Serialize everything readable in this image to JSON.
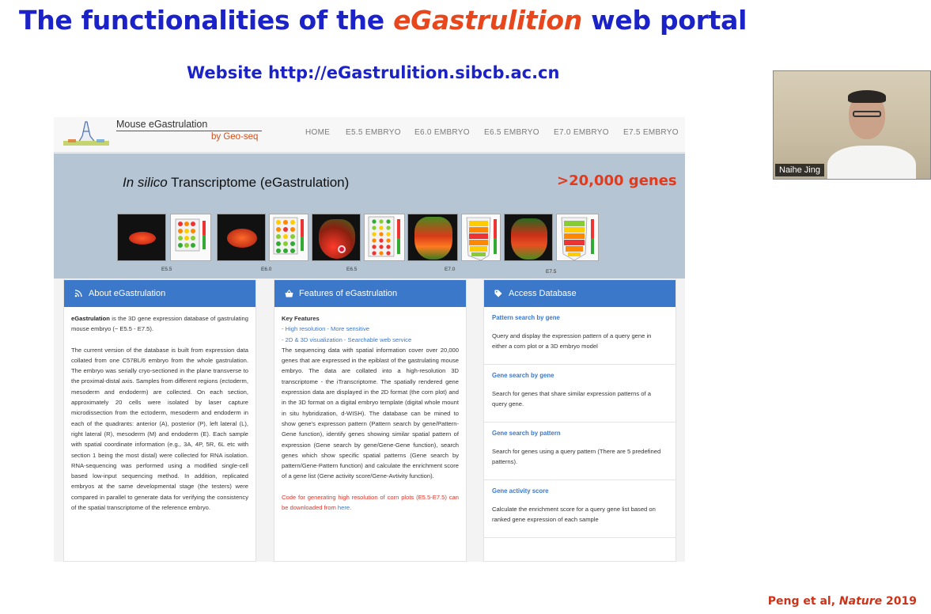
{
  "slide": {
    "title_before": "The functionalities of the ",
    "title_highlight": "eGastrulition",
    "title_after": " web portal",
    "website": "Website http://eGastrulition.sibcb.ac.cn",
    "citation_authors": "Peng et al, ",
    "citation_journal": "Nature",
    "citation_year": " 2019"
  },
  "webcam": {
    "participant_name": "Naihe Jing"
  },
  "site": {
    "logo_title": "Mouse  eGastrulation",
    "logo_sub": "by Geo-seq",
    "nav": [
      "HOME",
      "E5.5 EMBRYO",
      "E6.0 EMBRYO",
      "E6.5 EMBRYO",
      "E7.0 EMBRYO",
      "E7.5 EMBRYO"
    ],
    "hero": {
      "text_italic": "In silico",
      "text_rest": "  Transcriptome   (eGastrulation)",
      "genes": ">20,000 genes",
      "stages": [
        "E5.5",
        "E6.0",
        "E6.5",
        "E7.0",
        "E7.5"
      ]
    },
    "about": {
      "heading": "About eGastrulation",
      "bold_name": "eGastrulation",
      "intro": " is the 3D gene expression database of gastrulating mouse embryo (~ E5.5 - E7.5).",
      "body": "The current version of the database is built from expression data collated from one C57BL/6 embryo from the whole gastrulation. The embryo was serially cryo-sectioned in the plane transverse to the proximal-distal axis. Samples from different regions (ectoderm, mesoderm and endoderm) are collected. On each section, approximately 20 cells were isolated by laser capture microdissection from the ectoderm, mesoderm and endoderm in each of the quadrants: anterior (A), posterior (P), left lateral (L), right lateral (R), mesoderm (M) and endoderm (E). Each sample with spatial coordinate information (e.g., 3A, 4P, 5R, 6L etc with section 1 being the most distal) were collected for RNA isolation. RNA-sequencing was performed using a modified single-cell based low-input sequencing method. In addition, replicated embryos at the same developmental stage (the testers) were compared in parallel to generate data for verifying the consistency of the spatial transcriptome of the reference embryo."
    },
    "features": {
      "heading": "Features of eGastrulation",
      "key_title": "Key Features",
      "bullet1": "- High resolution - More sensitive",
      "bullet2": "- 2D & 3D visualization - Searchable web service",
      "body": "The sequencing data with spatial information cover over 20,000 genes that are expressed in the epiblast of the gastrulating mouse embryo. The data are collated into a high-resolution 3D transcriptome - the iTranscriptome. The spatially rendered gene expression data are displayed in the 2D format (the corn plot) and in the 3D format on a digital embryo template (digital whole mount in situ hybridization, d-WISH). The database can be mined to show gene's expresson pattern (Pattern search by gene/Pattern-Gene function), identify genes showing similar spatial pattern of expression (Gene search by gene/Gene-Gene function), search genes which show specific spatial patterns (Gene search by pattern/Gene-Pattern function) and calculate the enrichment score of a gene list (Gene activity score/Gene-Avtivity function).",
      "code_text": "Code for generating high resolution of corn plots (E5.5-E7.5) can be downloaded from ",
      "code_link": "here",
      "code_end": "."
    },
    "access": {
      "heading": "Access Database",
      "items": [
        {
          "title": "Pattern search by gene",
          "desc": "Query and display the expression pattern of a query gene in either a corn plot or a 3D embryo model"
        },
        {
          "title": "Gene search by gene",
          "desc": "Search for genes that share similar expression patterns of a query gene."
        },
        {
          "title": "Gene search by pattern",
          "desc": "Search for genes using a query pattern (There are 5 predefined patterns)."
        },
        {
          "title": "Gene activity score",
          "desc": "Calculate the enrichment score for a query gene list based on ranked gene expression of each sample"
        }
      ]
    }
  },
  "colors": {
    "title_blue": "#1a22c8",
    "highlight_orange": "#e8461c",
    "panel_blue": "#3b78c9",
    "hero_bg": "#b6c5d3",
    "genes_red": "#e23a1d"
  }
}
